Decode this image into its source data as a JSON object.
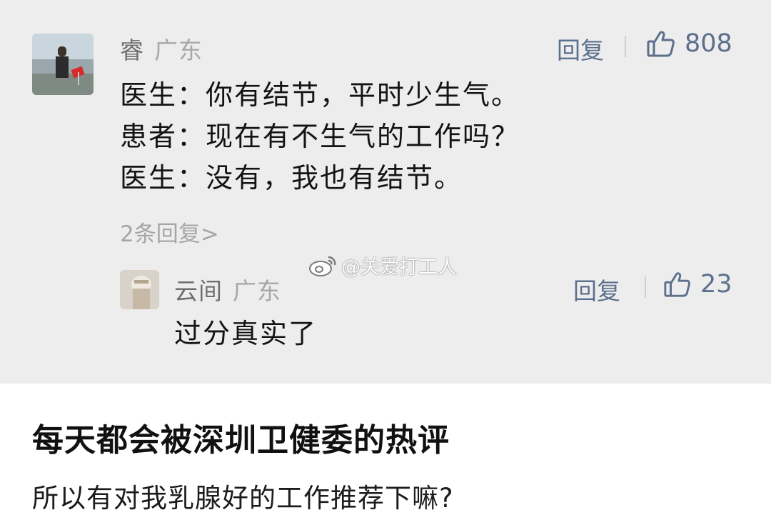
{
  "comment": {
    "username": "睿",
    "location": "广东",
    "reply_label": "回复",
    "like_count": "808",
    "lines": [
      "医生：你有结节，平时少生气。",
      "患者：现在有不生气的工作吗？",
      "医生：没有，我也有结节。"
    ],
    "replies_link": "2条回复>"
  },
  "sub_reply": {
    "username": "云间",
    "location": "广东",
    "reply_label": "回复",
    "like_count": "23",
    "text": "过分真实了"
  },
  "watermark": {
    "text": "@关爱打工人",
    "icon": "weibo-logo-icon"
  },
  "caption": {
    "headline": "每天都会被深圳卫健委的热评",
    "body": "所以有对我乳腺好的工作推荐下嘛?"
  },
  "icons": {
    "like": "thumbs-up-icon"
  },
  "colors": {
    "card_bg": "#ededed",
    "action_blue": "#5c6f8c",
    "muted_gray": "#a8a8a8"
  }
}
